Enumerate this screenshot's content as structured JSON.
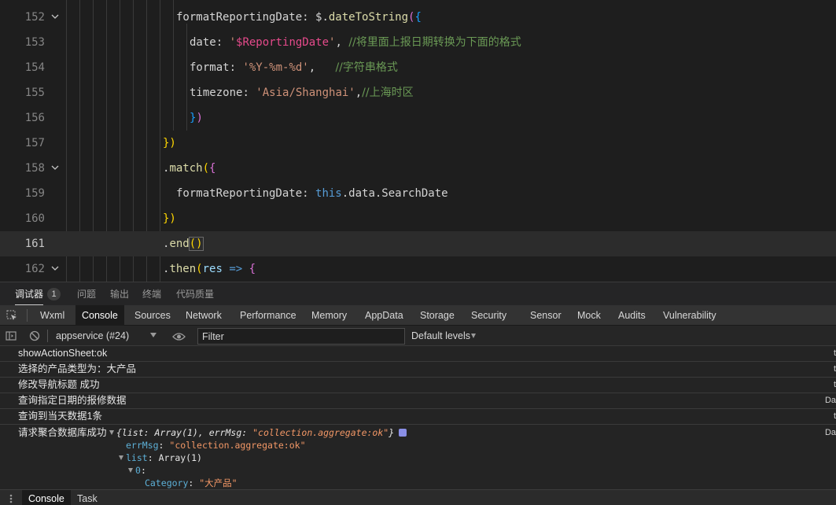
{
  "editor": {
    "lines": [
      {
        "num": "152",
        "fold": true
      },
      {
        "num": "153",
        "fold": false
      },
      {
        "num": "154",
        "fold": false
      },
      {
        "num": "155",
        "fold": false
      },
      {
        "num": "156",
        "fold": false
      },
      {
        "num": "157",
        "fold": false
      },
      {
        "num": "158",
        "fold": true
      },
      {
        "num": "159",
        "fold": false
      },
      {
        "num": "160",
        "fold": false
      },
      {
        "num": "161",
        "fold": false
      },
      {
        "num": "162",
        "fold": true
      }
    ],
    "code": {
      "l152_key": "formatReportingDate",
      "l152_colon": ": ",
      "l152_obj": "$.",
      "l152_fn": "dateToString",
      "l152_p": "(",
      "l152_b": "{",
      "l153_key": "date",
      "l153_colon": ": ",
      "l153_q1": "'",
      "l153_val": "$ReportingDate",
      "l153_q2": "'",
      "l153_comma": ", ",
      "l153_cmt": "//将里面上报日期转换为下面的格式",
      "l154_key": "format",
      "l154_colon": ": ",
      "l154_val": "'%Y-%m-%d'",
      "l154_comma": ",   ",
      "l154_cmt": "//字符串格式",
      "l155_key": "timezone",
      "l155_colon": ": ",
      "l155_val": "'Asia/Shanghai'",
      "l155_comma": ",",
      "l155_cmt": "//上海时区",
      "l156_b": "}",
      "l156_p": ")",
      "l157_b": "})",
      "l158_dot": ".",
      "l158_fn": "match",
      "l158_p": "(",
      "l158_b": "{",
      "l159_key": "formatReportingDate",
      "l159_colon": ": ",
      "l159_this": "this",
      "l159_rest": ".data.SearchDate",
      "l160_b": "})",
      "l161_dot": ".",
      "l161_fn": "end",
      "l161_p": "()",
      "l162_dot": ".",
      "l162_fn": "then",
      "l162_p": "(",
      "l162_arg": "res",
      "l162_arrow": " => ",
      "l162_b": "{"
    }
  },
  "panel_tabs": {
    "debugger": "调试器",
    "debugger_badge": "1",
    "problems": "问题",
    "output": "输出",
    "terminal": "终端",
    "code_quality": "代码质量"
  },
  "devtools_tabs": [
    "Wxml",
    "Console",
    "Sources",
    "Network",
    "Performance",
    "Memory",
    "AppData",
    "Storage",
    "Security",
    "Sensor",
    "Mock",
    "Audits",
    "Vulnerability"
  ],
  "console_toolbar": {
    "context": "appservice (#24)",
    "filter_placeholder": "Filter",
    "levels": "Default levels"
  },
  "console": {
    "logs": [
      {
        "text": "showActionSheet:ok",
        "src": "t"
      },
      {
        "text": "选择的产品类型为：大产品",
        "src": "t"
      },
      {
        "text": "修改导航标题 成功",
        "src": "t"
      },
      {
        "text": "查询指定日期的报修数据",
        "src": "Da"
      },
      {
        "text": "查询到当天数据1条",
        "src": "t"
      },
      {
        "text": "请求聚合数据库成功",
        "src": "Da"
      }
    ],
    "object": {
      "summary_open": "{list: ",
      "summary_arr": "Array(1)",
      "summary_mid": ", errMsg: ",
      "summary_msg": "\"collection.aggregate:ok\"",
      "summary_close": "}",
      "errmsg_key": "errMsg",
      "errmsg_val": "\"collection.aggregate:ok\"",
      "list_key": "list",
      "list_val": "Array(1)",
      "index_key": "0",
      "category_key": "Category",
      "category_val": "\"大产品\""
    }
  },
  "drawer_tabs": {
    "console": "Console",
    "task": "Task"
  },
  "colors": {
    "accent_string": "#ce9178",
    "accent_variable": "#e54a8b",
    "accent_comment": "#6a9955",
    "accent_keyword": "#569cd6"
  }
}
